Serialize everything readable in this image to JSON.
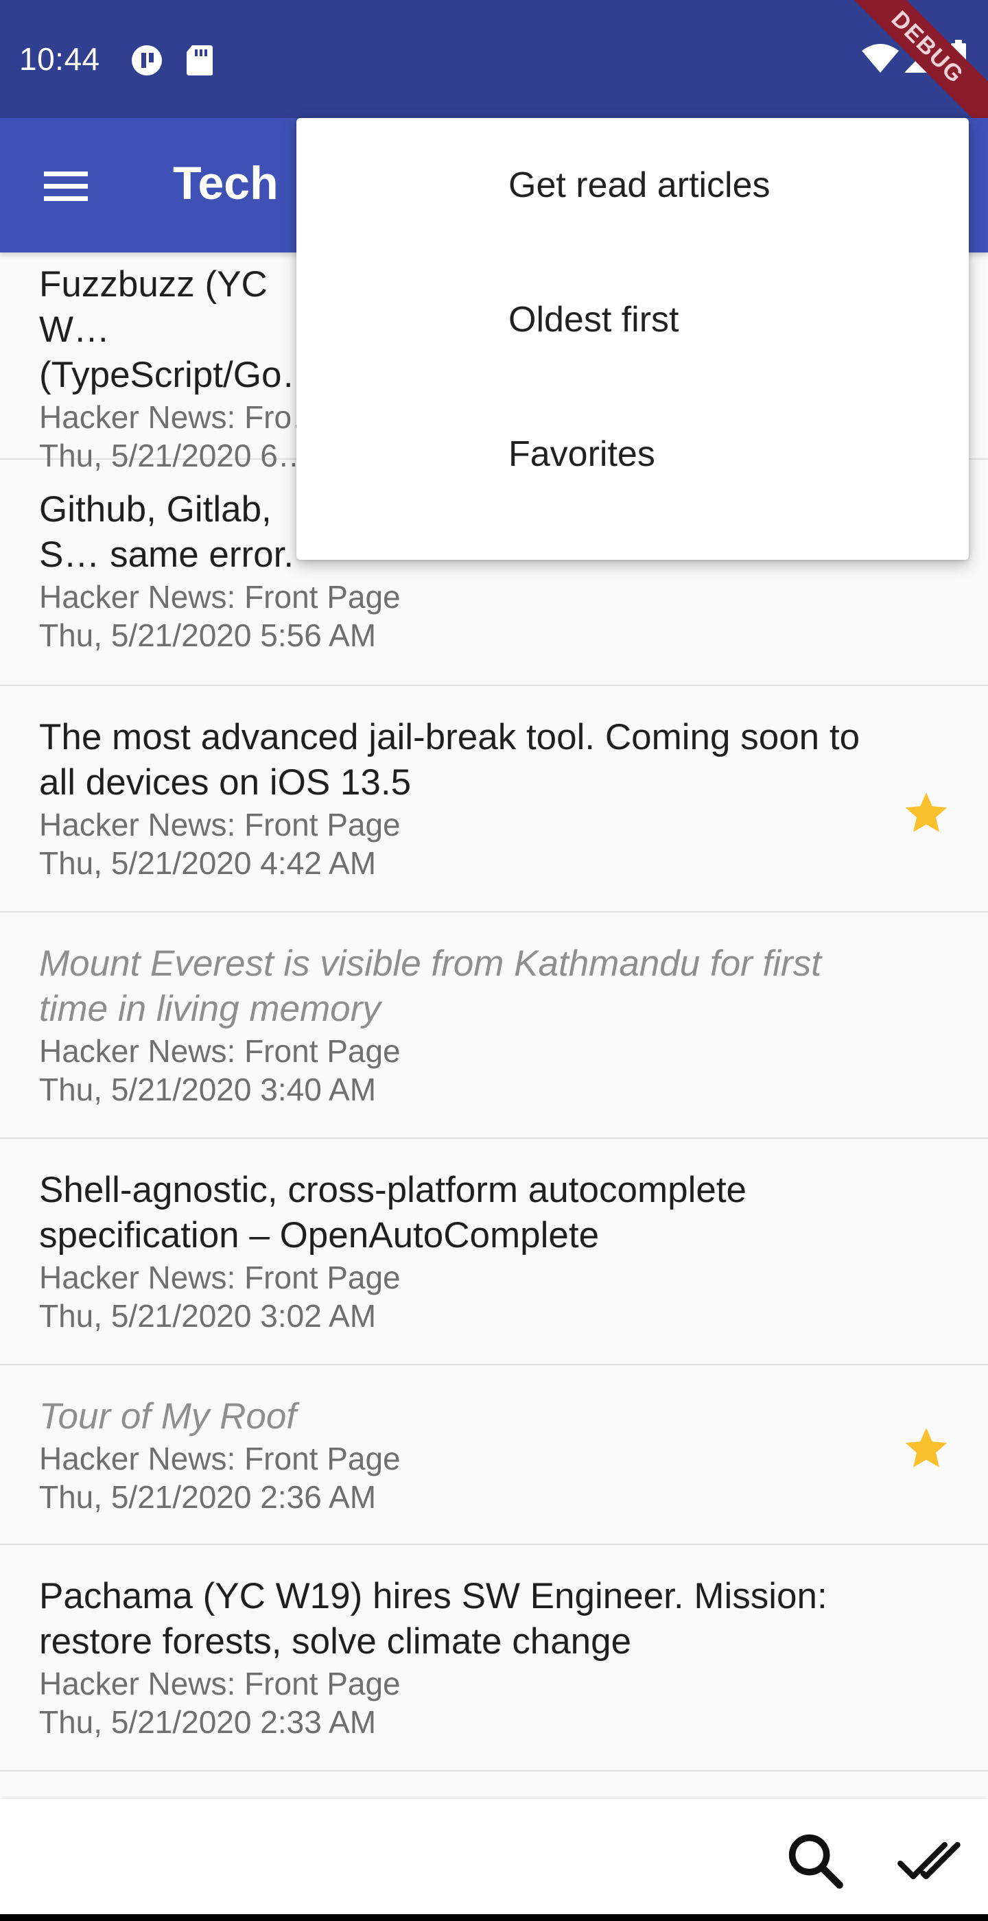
{
  "status_bar": {
    "time": "10:44",
    "icons": [
      "media-pause-icon",
      "sd-card-icon",
      "wifi-icon",
      "signal-icon",
      "battery-icon"
    ],
    "debug_banner": "DEBUG"
  },
  "app_bar": {
    "title": "Tech",
    "menu_icon": "menu-icon"
  },
  "popup_menu": {
    "items": [
      {
        "label": "Get read articles"
      },
      {
        "label": "Oldest first"
      },
      {
        "label": "Favorites"
      }
    ]
  },
  "articles": [
    {
      "title": "Fuzzbuzz (YC W… (TypeScript/Go…",
      "source": "Hacker News: Fro…",
      "date": "Thu, 5/21/2020 6…",
      "read": false,
      "favorite": false
    },
    {
      "title": "Github, Gitlab, S… same error.",
      "source": "Hacker News: Front Page",
      "date": "Thu, 5/21/2020 5:56 AM",
      "read": false,
      "favorite": false
    },
    {
      "title": "The most advanced jail-break tool. Coming soon to all devices on iOS 13.5",
      "source": "Hacker News: Front Page",
      "date": "Thu, 5/21/2020 4:42 AM",
      "read": false,
      "favorite": true
    },
    {
      "title": "Mount Everest is visible from Kathmandu for first time in living memory",
      "source": "Hacker News: Front Page",
      "date": "Thu, 5/21/2020 3:40 AM",
      "read": true,
      "favorite": false
    },
    {
      "title": "Shell-agnostic, cross-platform autocomplete specification – OpenAutoComplete",
      "source": "Hacker News: Front Page",
      "date": "Thu, 5/21/2020 3:02 AM",
      "read": false,
      "favorite": false
    },
    {
      "title": "Tour of My Roof",
      "source": "Hacker News: Front Page",
      "date": "Thu, 5/21/2020 2:36 AM",
      "read": true,
      "favorite": true
    },
    {
      "title": "Pachama (YC W19) hires SW Engineer. Mission: restore forests, solve climate change",
      "source": "Hacker News: Front Page",
      "date": "Thu, 5/21/2020 2:33 AM",
      "read": false,
      "favorite": false
    }
  ],
  "bottom_bar": {
    "actions": [
      {
        "name": "search",
        "icon": "search-icon"
      },
      {
        "name": "mark-all-read",
        "icon": "double-check-icon"
      }
    ]
  },
  "colors": {
    "status_bar": "#303f8f",
    "app_bar": "#3f51b5",
    "favorite_star": "#fbc02d",
    "read_title": "#8e8e8e",
    "debug_banner": "#8a1c2b"
  }
}
